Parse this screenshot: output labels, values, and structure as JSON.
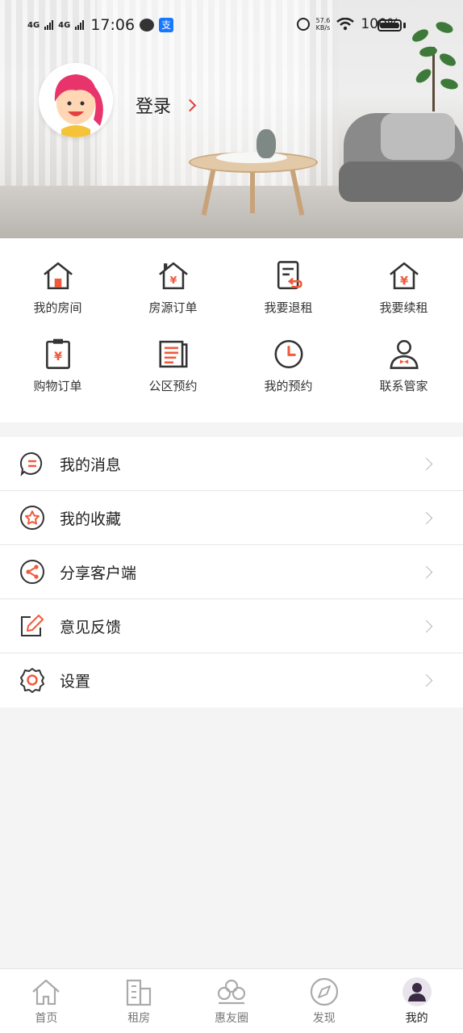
{
  "status_bar": {
    "network1": "4G",
    "network2": "4G",
    "time": "17:06",
    "alipay_glyph": "支",
    "net_speed_value": "57.6",
    "net_speed_unit": "KB/s",
    "battery": "100%"
  },
  "profile": {
    "login_label": "登录",
    "avatar_icon": "girl-avatar-icon"
  },
  "grid": {
    "items": [
      {
        "label": "我的房间",
        "icon": "house-icon"
      },
      {
        "label": "房源订单",
        "icon": "house-yen-icon"
      },
      {
        "label": "我要退租",
        "icon": "document-return-icon"
      },
      {
        "label": "我要续租",
        "icon": "house-yen-renew-icon"
      },
      {
        "label": "购物订单",
        "icon": "clipboard-yen-icon"
      },
      {
        "label": "公区预约",
        "icon": "newspaper-icon"
      },
      {
        "label": "我的预约",
        "icon": "clock-icon"
      },
      {
        "label": "联系管家",
        "icon": "butler-icon"
      }
    ]
  },
  "menu": {
    "items": [
      {
        "label": "我的消息",
        "icon": "message-icon"
      },
      {
        "label": "我的收藏",
        "icon": "star-icon"
      },
      {
        "label": "分享客户端",
        "icon": "share-icon"
      },
      {
        "label": "意见反馈",
        "icon": "edit-icon"
      },
      {
        "label": "设置",
        "icon": "gear-icon"
      }
    ]
  },
  "bottom_nav": {
    "items": [
      {
        "label": "首页",
        "icon": "home-icon"
      },
      {
        "label": "租房",
        "icon": "building-icon"
      },
      {
        "label": "惠友圈",
        "icon": "group-icon"
      },
      {
        "label": "发现",
        "icon": "compass-icon"
      },
      {
        "label": "我的",
        "icon": "user-icon",
        "active": true
      }
    ]
  },
  "colors": {
    "accent": "#f05a3c",
    "icon_dark": "#333333"
  }
}
